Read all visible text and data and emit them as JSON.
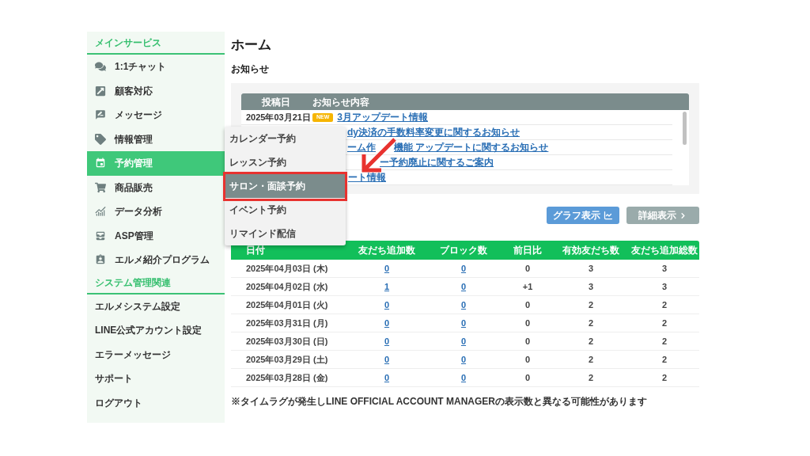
{
  "sidebar": {
    "sections": [
      {
        "title": "メインサービス",
        "items": [
          {
            "label": "1:1チャット",
            "selected": false
          },
          {
            "label": "顧客対応",
            "selected": false
          },
          {
            "label": "メッセージ",
            "selected": false
          },
          {
            "label": "情報管理",
            "selected": false
          },
          {
            "label": "予約管理",
            "selected": true
          },
          {
            "label": "商品販売",
            "selected": false
          },
          {
            "label": "データ分析",
            "selected": false
          },
          {
            "label": "ASP管理",
            "selected": false
          },
          {
            "label": "エルメ紹介プログラム",
            "selected": false
          }
        ]
      },
      {
        "title": "システム管理関連",
        "items": [
          {
            "label": "エルメシステム設定",
            "selected": false
          },
          {
            "label": "LINE公式アカウント設定",
            "selected": false
          },
          {
            "label": "エラーメッセージ",
            "selected": false
          },
          {
            "label": "サポート",
            "selected": false
          },
          {
            "label": "ログアウト",
            "selected": false
          }
        ]
      }
    ]
  },
  "submenu": {
    "items": [
      {
        "label": "カレンダー予約",
        "selected": false
      },
      {
        "label": "レッスン予約",
        "selected": false
      },
      {
        "label": "サロン・面談予約",
        "selected": true
      },
      {
        "label": "イベント予約",
        "selected": false
      },
      {
        "label": "リマインド配信",
        "selected": false
      }
    ]
  },
  "page": {
    "title": "ホーム"
  },
  "notices": {
    "heading": "お知らせ",
    "columns": [
      "投稿日",
      "お知らせ内容"
    ],
    "rows": [
      {
        "date": "2025年03月21日",
        "badge": "NEW",
        "title_parts": [
          "3月アップデート情報"
        ]
      },
      {
        "title_parts": [
          "dy決済の手数料率変更に関するお知らせ"
        ]
      },
      {
        "title_parts": [
          "ーム作",
          "機能 アップデートに関するお知らせ"
        ]
      },
      {
        "title_parts": [
          "ー予約廃止に関するご案内"
        ]
      },
      {
        "title_parts": [
          "ート情報"
        ]
      }
    ]
  },
  "buttons": [
    {
      "label": "グラフ表示",
      "kind": "primary"
    },
    {
      "label": "詳細表示",
      "kind": "secondary"
    }
  ],
  "stats": {
    "columns": [
      {
        "label": "日付",
        "kind": "date"
      },
      {
        "label": "友だち追加数",
        "kind": "link"
      },
      {
        "label": "ブロック数",
        "kind": "link"
      },
      {
        "label": "前日比",
        "kind": "text"
      },
      {
        "label": "有効友だち数",
        "kind": "text"
      },
      {
        "label": "友だち追加総数",
        "kind": "text"
      }
    ],
    "rows": [
      [
        "2025年04月03日 (木)",
        "0",
        "0",
        "0",
        "3",
        "3"
      ],
      [
        "2025年04月02日 (水)",
        "1",
        "0",
        "+1",
        "3",
        "3"
      ],
      [
        "2025年04月01日 (火)",
        "0",
        "0",
        "0",
        "2",
        "2"
      ],
      [
        "2025年03月31日 (月)",
        "0",
        "0",
        "0",
        "2",
        "2"
      ],
      [
        "2025年03月30日 (日)",
        "0",
        "0",
        "0",
        "2",
        "2"
      ],
      [
        "2025年03月29日 (土)",
        "0",
        "0",
        "0",
        "2",
        "2"
      ],
      [
        "2025年03月28日 (金)",
        "0",
        "0",
        "0",
        "2",
        "2"
      ]
    ]
  },
  "footnote": "※タイムラグが発生しLINE OFFICIAL ACCOUNT MANAGERの表示数と異なる可能性があります"
}
